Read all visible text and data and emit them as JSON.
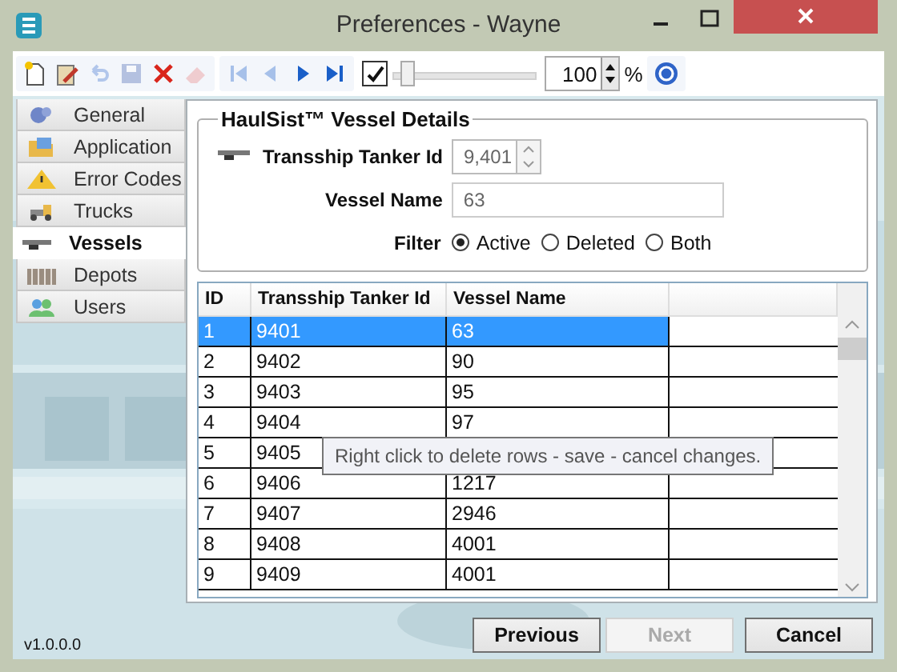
{
  "window": {
    "title": "Preferences - Wayne"
  },
  "toolbar": {
    "buttons": [
      {
        "kind": "new",
        "disabled": false
      },
      {
        "kind": "edit",
        "disabled": false
      },
      {
        "kind": "undo",
        "disabled": true
      },
      {
        "kind": "save",
        "disabled": true
      },
      {
        "kind": "delete",
        "disabled": false
      },
      {
        "kind": "erase",
        "disabled": true
      },
      {
        "kind": "first",
        "disabled": true
      },
      {
        "kind": "prev",
        "disabled": true
      },
      {
        "kind": "next",
        "disabled": false
      },
      {
        "kind": "last",
        "disabled": false
      }
    ],
    "checkbox": {
      "checked": true
    },
    "zoom": {
      "level": 0.06,
      "value": "100",
      "unit": "%"
    }
  },
  "nav": {
    "items": [
      {
        "label": "General",
        "selected": false
      },
      {
        "label": "Application",
        "selected": false
      },
      {
        "label": "Error Codes",
        "selected": false
      },
      {
        "label": "Trucks",
        "selected": false
      },
      {
        "label": "Vessels",
        "selected": true
      },
      {
        "label": "Depots",
        "selected": false
      },
      {
        "label": "Users",
        "selected": false
      }
    ]
  },
  "details": {
    "title": "HaulSist™ Vessel Details",
    "fields": [
      {
        "label": "Transship Tanker Id",
        "value": "9,401",
        "kind": "spinner"
      },
      {
        "label": "Vessel Name",
        "value": "63",
        "kind": "text"
      }
    ],
    "filter": {
      "label": "Filter",
      "options": [
        {
          "label": "Active",
          "selected": true
        },
        {
          "label": "Deleted",
          "selected": false
        },
        {
          "label": "Both",
          "selected": false
        }
      ]
    }
  },
  "grid": {
    "columns": [
      "ID",
      "Transship Tanker Id",
      "Vessel Name"
    ],
    "rows": [
      {
        "cells": [
          "1",
          "9401",
          "63"
        ],
        "selected": true
      },
      {
        "cells": [
          "2",
          "9402",
          "90"
        ],
        "selected": false
      },
      {
        "cells": [
          "3",
          "9403",
          "95"
        ],
        "selected": false
      },
      {
        "cells": [
          "4",
          "9404",
          "97"
        ],
        "selected": false
      },
      {
        "cells": [
          "5",
          "9405"
        ],
        "selected": false
      },
      {
        "cells": [
          "6",
          "9406",
          "1217"
        ],
        "selected": false
      },
      {
        "cells": [
          "7",
          "9407",
          "2946"
        ],
        "selected": false
      },
      {
        "cells": [
          "8",
          "9408",
          "4001"
        ],
        "selected": false
      },
      {
        "cells": [
          "9",
          "9409",
          "4001"
        ],
        "selected": false
      }
    ]
  },
  "tooltip": "Right click to delete rows - save - cancel changes.",
  "version": "v1.0.0.0",
  "buttons": [
    {
      "label": "Previous",
      "disabled": false
    },
    {
      "label": "Next",
      "disabled": true
    },
    {
      "label": "Cancel",
      "disabled": false
    }
  ]
}
